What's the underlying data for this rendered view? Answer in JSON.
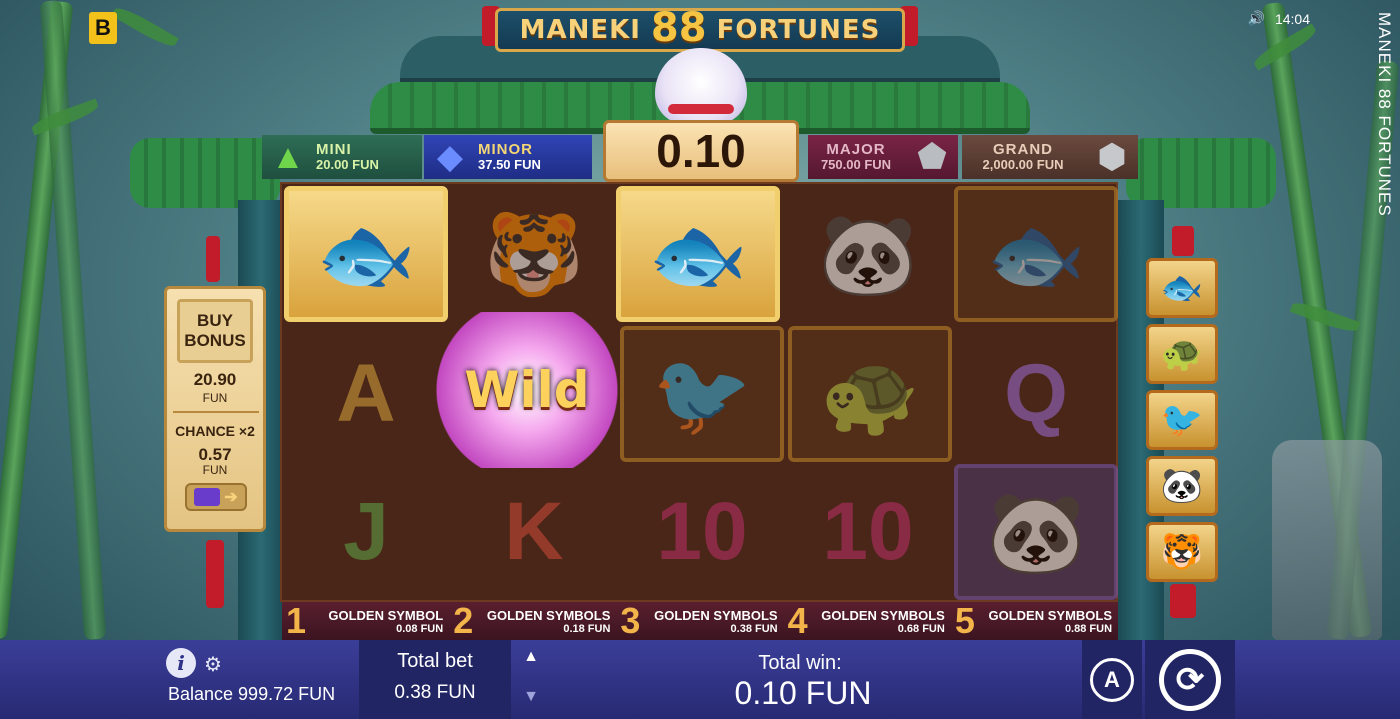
{
  "header": {
    "brand_letter": "B",
    "time": "14:04",
    "vertical_title": "MANEKI 88 FORTUNES",
    "logo_left": "MANEKI",
    "logo_number": "88",
    "logo_right": "FORTUNES"
  },
  "jackpots": [
    {
      "name": "MINI",
      "value": "20.00 FUN",
      "gem": "green-triangle-gem-icon"
    },
    {
      "name": "MINOR",
      "value": "37.50 FUN",
      "gem": "blue-diamond-gem-icon"
    },
    {
      "name": "MAJOR",
      "value": "750.00 FUN",
      "gem": "silver-pentagon-gem-icon"
    },
    {
      "name": "GRAND",
      "value": "2,000.00 FUN",
      "gem": "silver-hexagon-gem-icon"
    }
  ],
  "bet_display": "0.10",
  "reels": {
    "wild_label": "Wild",
    "letters": [
      "A",
      "Q",
      "J",
      "K",
      "10",
      "10"
    ],
    "symbols": [
      "golden-koi-fish",
      "tiger",
      "golden-koi-fish",
      "panda",
      "koi-fish",
      "phoenix",
      "turtle",
      "panda"
    ]
  },
  "paytable": [
    {
      "num": "1",
      "label": "GOLDEN SYMBOL",
      "value": "0.08 FUN"
    },
    {
      "num": "2",
      "label": "GOLDEN SYMBOLS",
      "value": "0.18 FUN"
    },
    {
      "num": "3",
      "label": "GOLDEN SYMBOLS",
      "value": "0.38 FUN"
    },
    {
      "num": "4",
      "label": "GOLDEN SYMBOLS",
      "value": "0.68 FUN"
    },
    {
      "num": "5",
      "label": "GOLDEN SYMBOLS",
      "value": "0.88 FUN"
    }
  ],
  "buy_panel": {
    "buy_line1": "BUY",
    "buy_line2": "BONUS",
    "buy_price": "20.90",
    "buy_unit": "FUN",
    "chance_title": "CHANCE ×2",
    "chance_price": "0.57",
    "chance_unit": "FUN"
  },
  "collection_symbols": [
    "golden-koi-icon",
    "golden-turtle-icon",
    "golden-phoenix-icon",
    "golden-panda-icon",
    "golden-tiger-icon"
  ],
  "controls": {
    "balance": "Balance 999.72 FUN",
    "total_bet_label": "Total bet",
    "total_bet_value": "0.38 FUN",
    "total_win_label": "Total win:",
    "total_win_value": "0.10 FUN",
    "auto_label": "A"
  },
  "colors": {
    "bar": "#2f3387",
    "gold": "#f2cf6d",
    "reel_bg": "#4a2618"
  }
}
